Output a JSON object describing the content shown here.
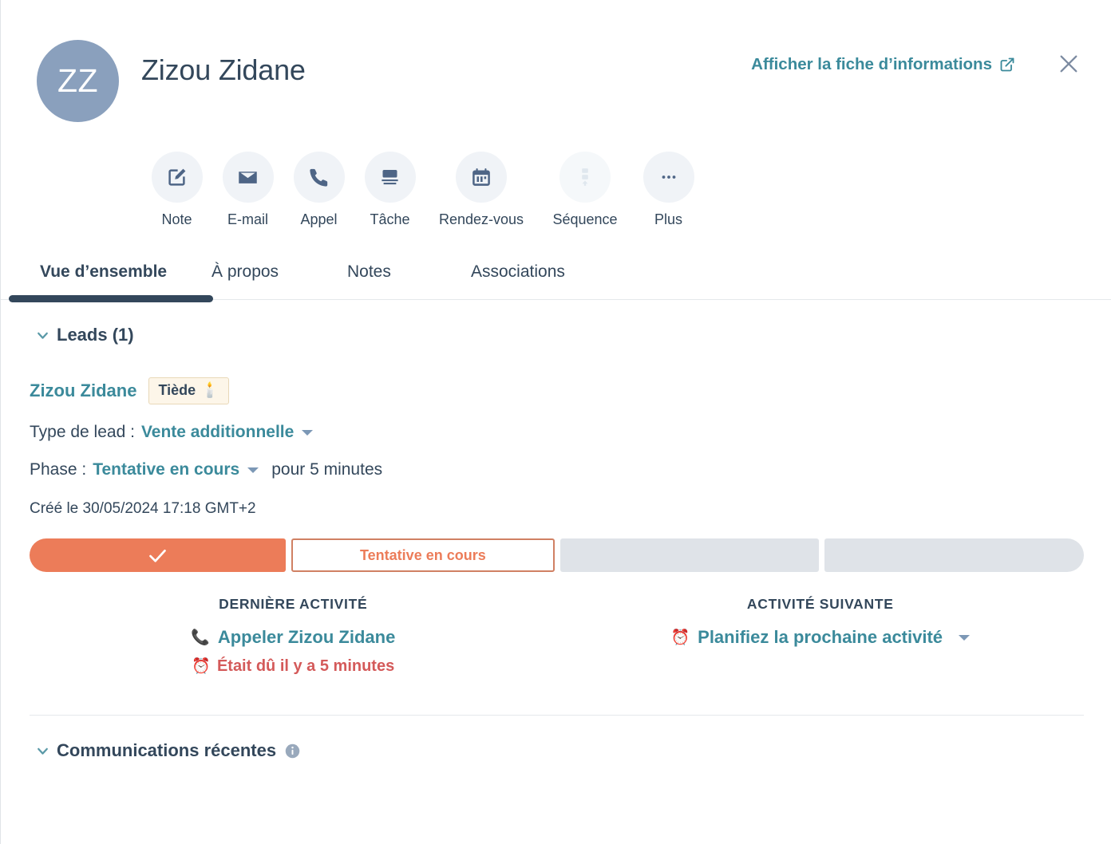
{
  "header": {
    "avatar_initials": "ZZ",
    "contact_name": "Zizou Zidane",
    "record_link_label": "Afficher la fiche d’informations",
    "external_link_icon": "external-link-icon",
    "close_icon": "close-icon"
  },
  "actions": [
    {
      "label": "Note",
      "icon": "note-pencil-icon",
      "disabled": false
    },
    {
      "label": "E-mail",
      "icon": "envelope-icon",
      "disabled": false
    },
    {
      "label": "Appel",
      "icon": "phone-icon",
      "disabled": false
    },
    {
      "label": "Tâche",
      "icon": "task-card-icon",
      "disabled": false
    },
    {
      "label": "Rendez-vous",
      "icon": "calendar-icon",
      "disabled": false
    },
    {
      "label": "Séquence",
      "icon": "sequence-icon",
      "disabled": true
    },
    {
      "label": "Plus",
      "icon": "ellipsis-icon",
      "disabled": false
    }
  ],
  "tabs": [
    {
      "label": "Vue d’ensemble",
      "active": true
    },
    {
      "label": "À propos",
      "active": false
    },
    {
      "label": "Notes",
      "active": false
    },
    {
      "label": "Associations",
      "active": false
    }
  ],
  "leads_section": {
    "title": "Leads (1)",
    "chevron_icon": "chevron-down-icon",
    "lead_name": "Zizou Zidane",
    "badge_label": "Tiède",
    "badge_emoji": "🕯️",
    "type_label": "Type de lead :",
    "type_value": "Vente additionnelle",
    "phase_label": "Phase :",
    "phase_value": "Tentative en cours",
    "phase_suffix": "pour 5 minutes",
    "created_text": "Créé le 30/05/2024 17:18 GMT+2",
    "pipeline": [
      {
        "label": "",
        "state": "completed",
        "icon": "check-icon"
      },
      {
        "label": "Tentative en cours",
        "state": "current"
      },
      {
        "label": "",
        "state": "upcoming"
      },
      {
        "label": "",
        "state": "upcoming"
      }
    ],
    "last_activity": {
      "heading": "DERNIÈRE ACTIVITÉ",
      "link_label": "Appeler Zizou Zidane",
      "link_emoji": "📞",
      "sub_label": "Était dû il y a 5 minutes",
      "sub_emoji": "⏰"
    },
    "next_activity": {
      "heading": "ACTIVITÉ SUIVANTE",
      "link_label": "Planifiez la prochaine activité",
      "link_emoji": "⏰"
    }
  },
  "communications_section": {
    "title": "Communications récentes",
    "chevron_icon": "chevron-down-icon",
    "info_icon": "info-icon"
  },
  "colors": {
    "accent_teal": "#3b8a9b",
    "navy": "#33475b",
    "orange": "#ec7c59",
    "red": "#d45a5a",
    "avatar_bg": "#8aa0bd",
    "badge_bg": "#fdf6e9"
  }
}
